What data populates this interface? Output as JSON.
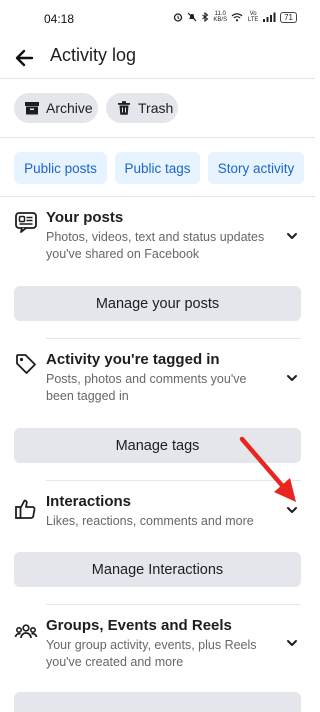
{
  "status_bar": {
    "time": "04:18",
    "data_rate": "11.0",
    "data_unit": "KB/S",
    "network": "Vo LTE",
    "battery": "71"
  },
  "header": {
    "title": "Activity log"
  },
  "top_buttons": {
    "archive": "Archive",
    "trash": "Trash"
  },
  "tabs": [
    "Public posts",
    "Public tags",
    "Story activity"
  ],
  "sections": [
    {
      "title": "Your posts",
      "description": "Photos, videos, text and status updates you've shared on Facebook",
      "button": "Manage your posts"
    },
    {
      "title": "Activity you're tagged in",
      "description": "Posts, photos and comments you've been tagged in",
      "button": "Manage tags"
    },
    {
      "title": "Interactions",
      "description": "Likes, reactions, comments and more",
      "button": "Manage Interactions"
    },
    {
      "title": "Groups, Events and Reels",
      "description": "Your group activity, events, plus Reels you've created and more"
    }
  ],
  "colors": {
    "tab_bg": "#e7f3ff",
    "tab_text": "#1b66c9",
    "button_bg": "#e4e6eb",
    "annotation_arrow": "#e8251f"
  },
  "icons": {
    "back": "arrow-left-icon",
    "archive": "archive-box-icon",
    "trash": "trash-icon",
    "your_posts": "posts-icon",
    "tagged": "tag-icon",
    "interactions": "thumbs-up-icon",
    "groups": "groups-icon",
    "expand": "chevron-down-icon"
  }
}
